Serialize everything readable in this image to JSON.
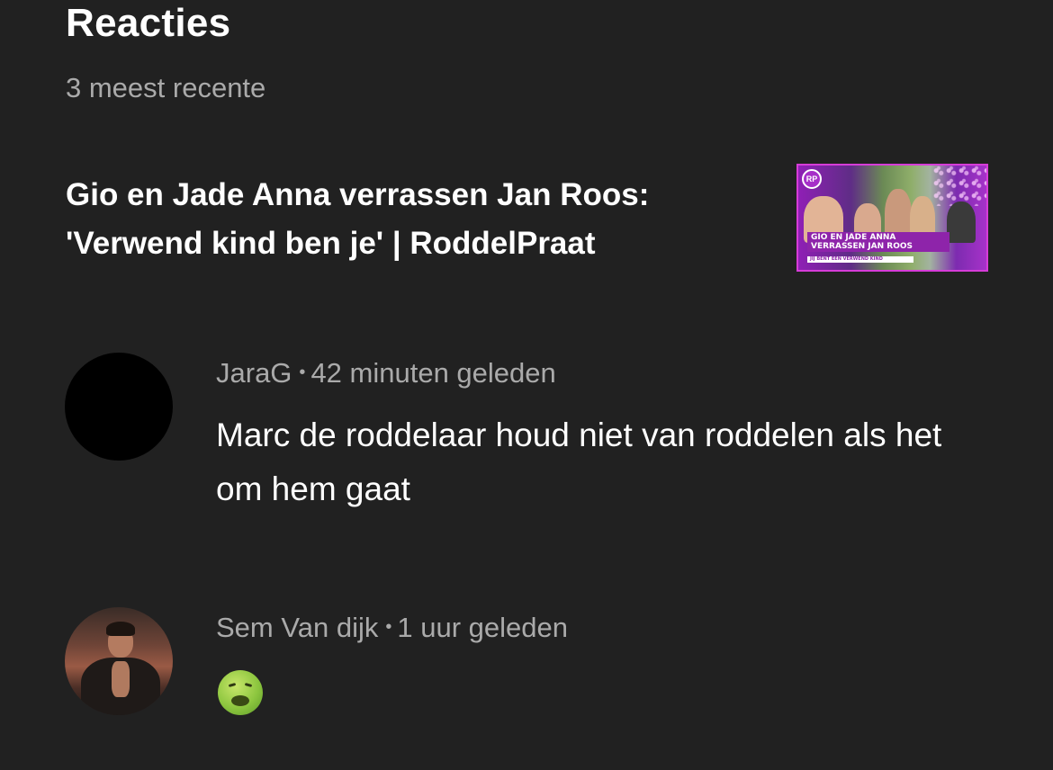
{
  "section": {
    "title": "Reacties",
    "subtitle": "3 meest recente"
  },
  "video": {
    "title": "Gio en Jade Anna verrassen Jan Roos: 'Verwend kind ben je' | RoddelPraat",
    "thumbnail": {
      "logo_text": "RP",
      "caption": "Gio en Jade Anna verrassen Jan Roos",
      "subcaption": "Jij bent een verwend kind",
      "border_color": "#d63cd8",
      "accent_color": "#8e24aa"
    }
  },
  "comments": [
    {
      "author": "JaraG",
      "separator": "•",
      "time": "42 minuten geleden",
      "text": "Marc de roddelaar houd niet van roddelen als het om hem gaat",
      "avatar": "black-circle-avatar"
    },
    {
      "author": "Sem Van dijk",
      "separator": "•",
      "time": "1 uur geleden",
      "text": "",
      "emoji": "nauseated-face-icon",
      "avatar": "photo-avatar"
    }
  ],
  "colors": {
    "background": "#212121",
    "primary_text": "#ffffff",
    "secondary_text": "#aaaaaa"
  }
}
